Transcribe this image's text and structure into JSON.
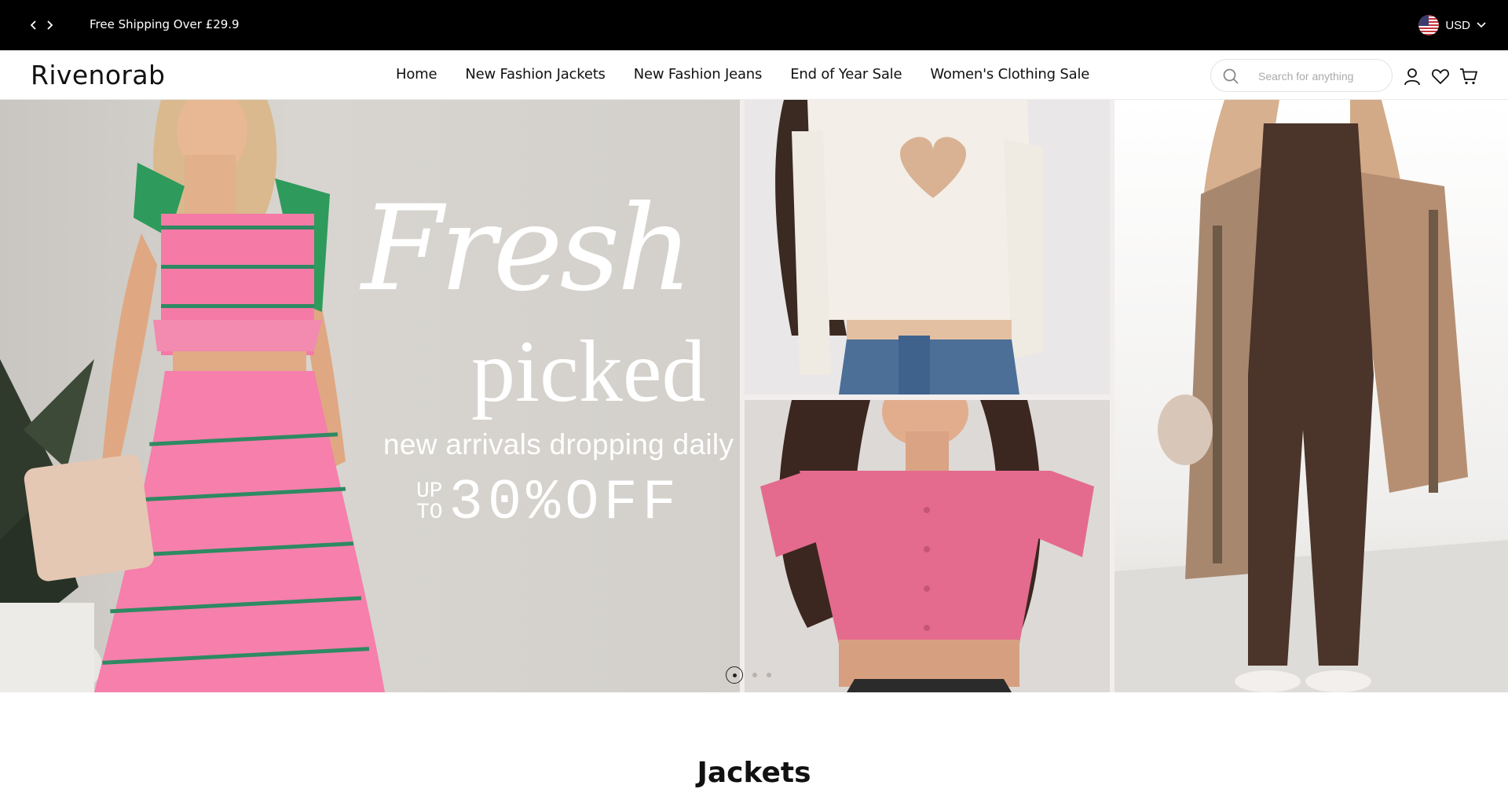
{
  "announcement": {
    "text": "Free Shipping Over £29.9",
    "prev_icon": "chevron-left-icon",
    "next_icon": "chevron-right-icon"
  },
  "currency": {
    "label": "USD",
    "flag": "us-flag-icon"
  },
  "header": {
    "logo": "Rivenorab",
    "nav": [
      {
        "label": "Home"
      },
      {
        "label": "New Fashion Jackets"
      },
      {
        "label": "New Fashion Jeans"
      },
      {
        "label": "End of Year Sale"
      },
      {
        "label": "Women's Clothing Sale"
      }
    ],
    "search": {
      "placeholder": "Search for anything"
    },
    "icons": [
      "account-icon",
      "wishlist-heart-icon",
      "cart-icon"
    ]
  },
  "hero": {
    "line1": "Fresh",
    "line2": "picked",
    "line3": "new arrivals dropping daily",
    "upto_top": "UP",
    "upto_bottom": "TO",
    "discount": "30%OFF",
    "slides": {
      "count": 3,
      "active": 1
    }
  },
  "section": {
    "title": "Jackets"
  },
  "colors": {
    "topbar": "#000000",
    "text": "#111111",
    "pink_knit": "#f57aa6",
    "green_stripe": "#2e8a62"
  }
}
